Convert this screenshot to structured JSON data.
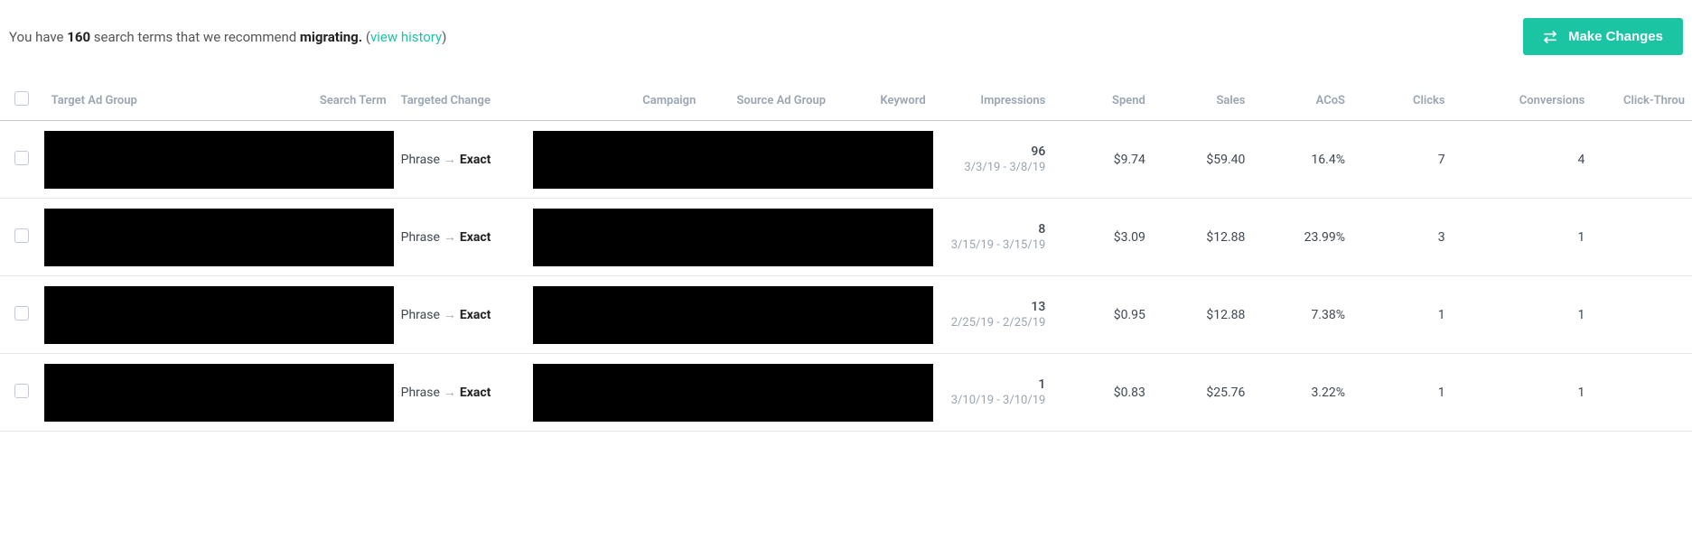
{
  "header": {
    "prefix": "You have ",
    "count": "160",
    "middle": " search terms that we recommend ",
    "action_word": "migrating.",
    "paren_open": " (",
    "link": "view history",
    "paren_close": ")"
  },
  "buttons": {
    "make_changes": "Make Changes"
  },
  "columns": {
    "target_ad_group": "Target Ad Group",
    "search_term": "Search Term",
    "targeted_change": "Targeted Change",
    "campaign": "Campaign",
    "source_ad_group": "Source Ad Group",
    "keyword": "Keyword",
    "impressions": "Impressions",
    "spend": "Spend",
    "sales": "Sales",
    "acos": "ACoS",
    "clicks": "Clicks",
    "conversions": "Conversions",
    "ctr": "Click-Throu"
  },
  "change": {
    "from": "Phrase",
    "arrow": "→",
    "to": "Exact"
  },
  "rows": [
    {
      "impressions": "96",
      "dates": "3/3/19 - 3/8/19",
      "spend": "$9.74",
      "sales": "$59.40",
      "acos": "16.4%",
      "clicks": "7",
      "conversions": "4"
    },
    {
      "impressions": "8",
      "dates": "3/15/19 - 3/15/19",
      "spend": "$3.09",
      "sales": "$12.88",
      "acos": "23.99%",
      "clicks": "3",
      "conversions": "1"
    },
    {
      "impressions": "13",
      "dates": "2/25/19 - 2/25/19",
      "spend": "$0.95",
      "sales": "$12.88",
      "acos": "7.38%",
      "clicks": "1",
      "conversions": "1"
    },
    {
      "impressions": "1",
      "dates": "3/10/19 - 3/10/19",
      "spend": "$0.83",
      "sales": "$25.76",
      "acos": "3.22%",
      "clicks": "1",
      "conversions": "1"
    }
  ]
}
